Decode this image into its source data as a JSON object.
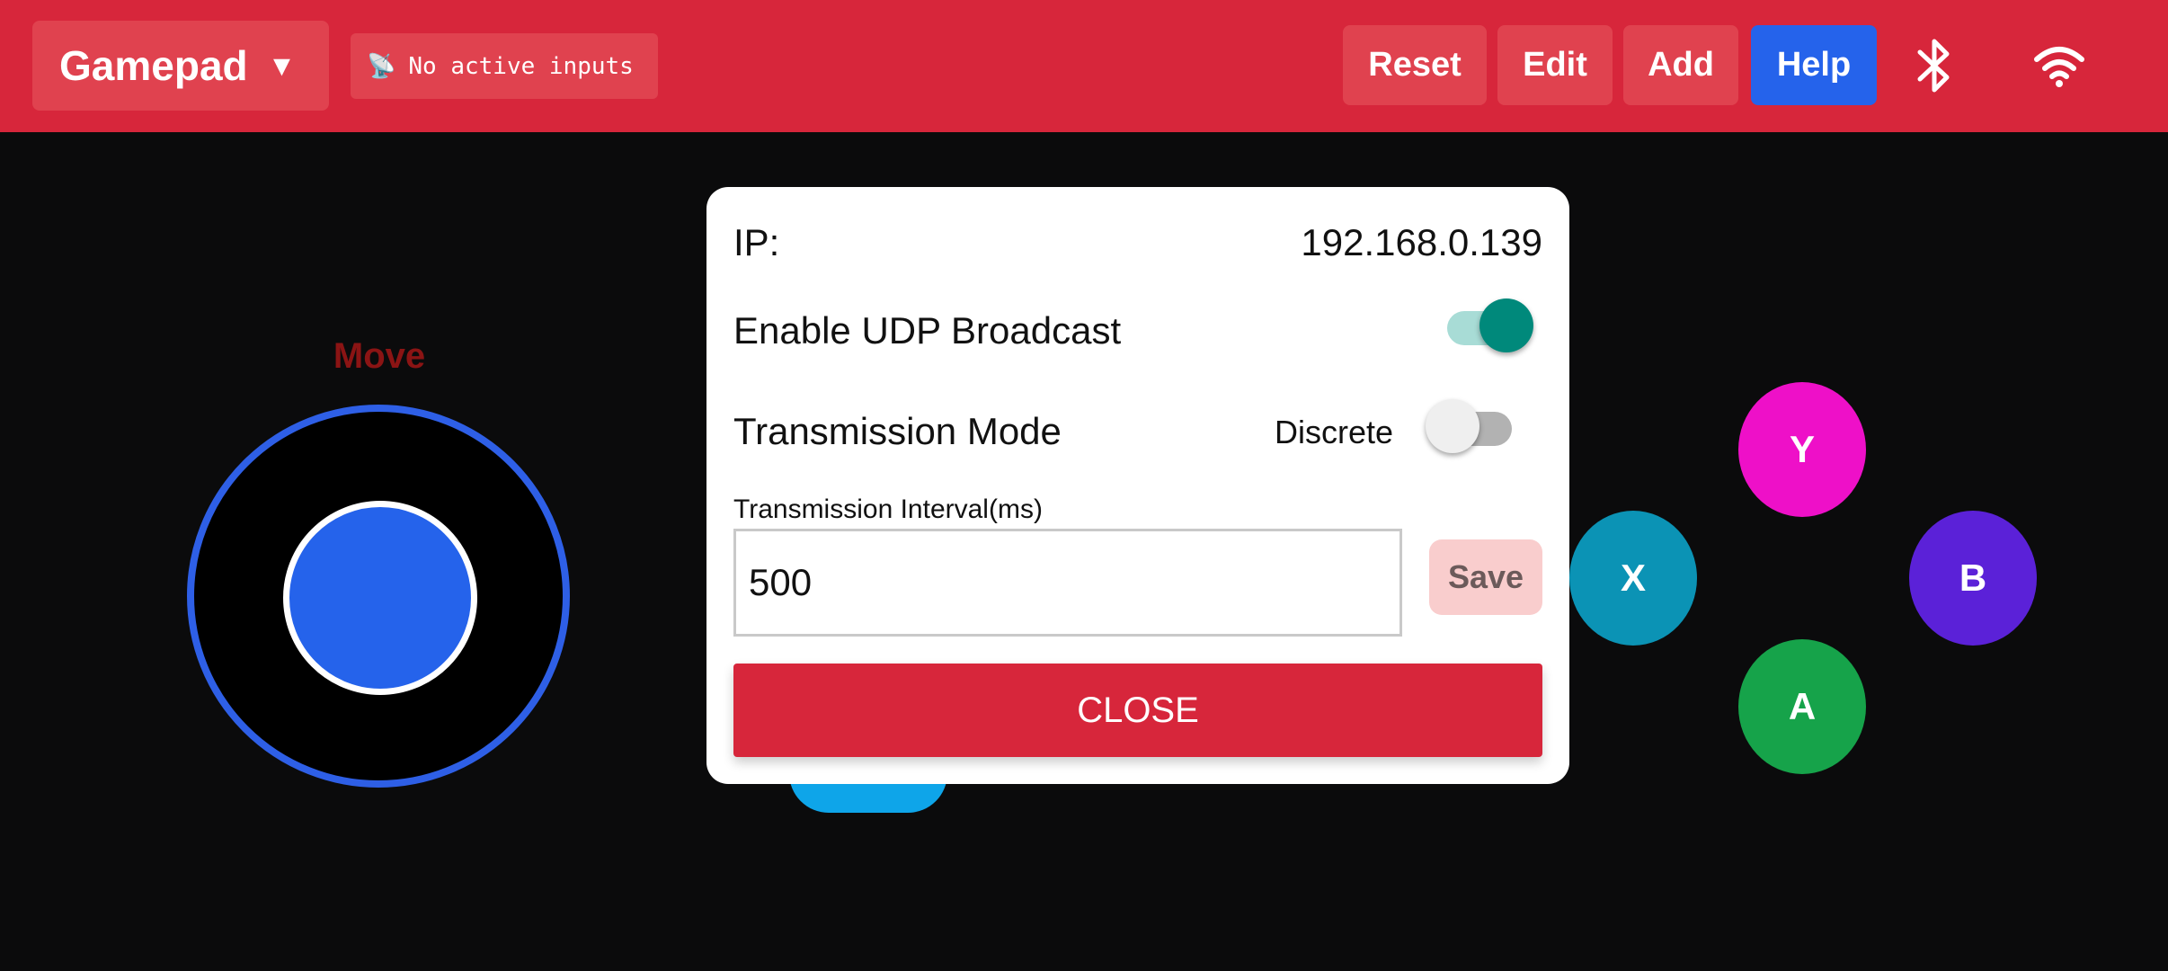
{
  "toolbar": {
    "profile_label": "Gamepad",
    "profile_caret": "▼",
    "status_icon": "📡",
    "status_text": "No active inputs",
    "buttons": {
      "reset": "Reset",
      "edit": "Edit",
      "add": "Add",
      "help": "Help"
    },
    "icons": [
      "bluetooth-icon",
      "wifi-icon"
    ]
  },
  "gamepad": {
    "joystick_label": "Move",
    "face_buttons": {
      "y": {
        "label": "Y",
        "color": "#ee10c8"
      },
      "x": {
        "label": "X",
        "color": "#0b93b5"
      },
      "b": {
        "label": "B",
        "color": "#5b21d8"
      },
      "a": {
        "label": "A",
        "color": "#16a34a"
      }
    }
  },
  "dialog": {
    "ip_label": "IP:",
    "ip_value": "192.168.0.139",
    "udp_label": "Enable UDP Broadcast",
    "udp_enabled": true,
    "mode_label": "Transmission Mode",
    "mode_value": "Discrete",
    "mode_toggle_on": false,
    "interval_label": "Transmission Interval(ms)",
    "interval_value": "500",
    "save_label": "Save",
    "close_label": "CLOSE"
  },
  "colors": {
    "toolbar_bg": "#d7263b",
    "accent_blue": "#2563eb",
    "toggle_on": "#00897b"
  }
}
